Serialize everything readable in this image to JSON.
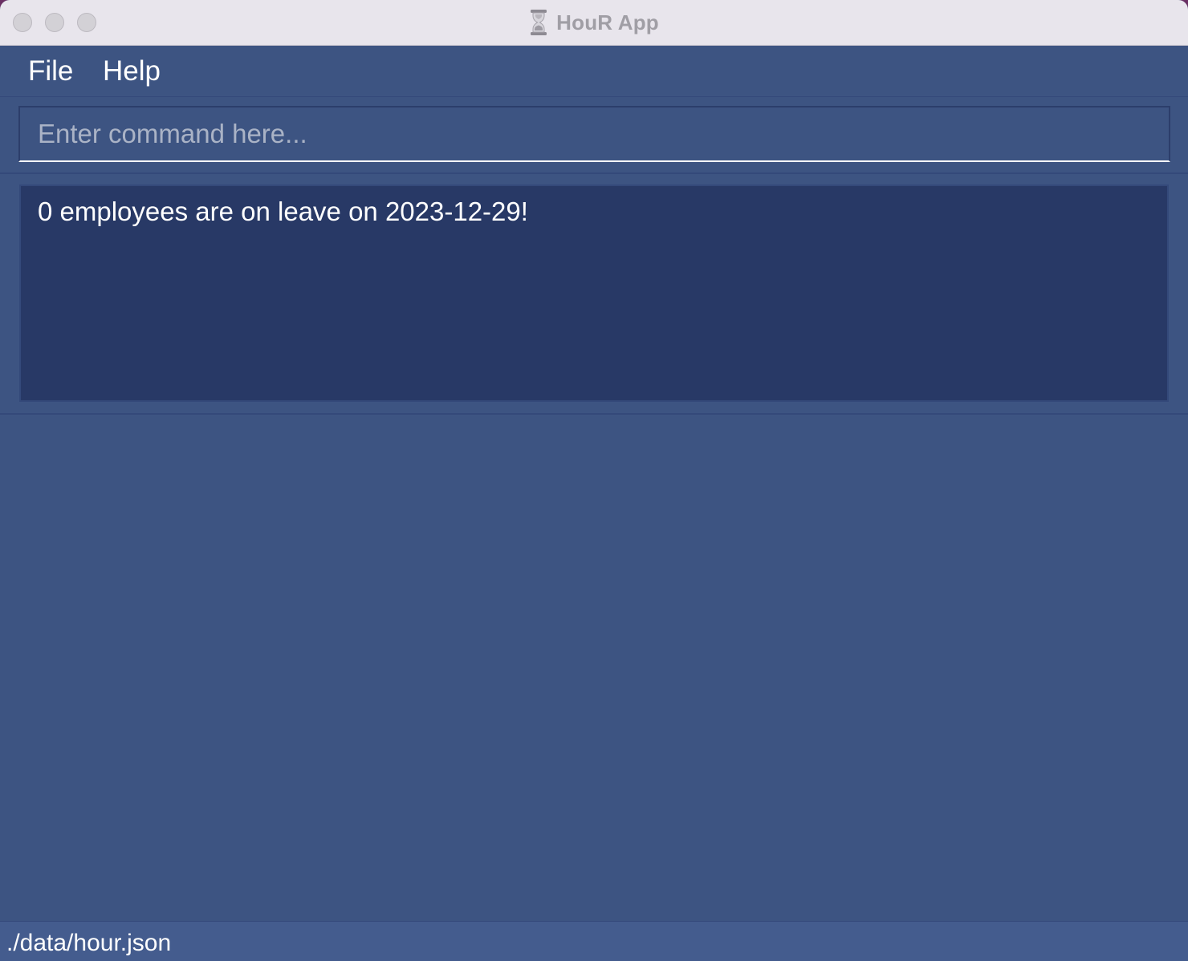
{
  "window": {
    "title": "HouR App",
    "title_icon": "hourglass-icon"
  },
  "menubar": {
    "items": [
      {
        "label": "File"
      },
      {
        "label": "Help"
      }
    ]
  },
  "command": {
    "placeholder": "Enter command here...",
    "value": ""
  },
  "result": {
    "message": "0 employees are on leave on 2023-12-29!"
  },
  "statusbar": {
    "path": "./data/hour.json"
  },
  "colors": {
    "background": "#3d5482",
    "result_background": "#283966",
    "titlebar": "#e8e5ec",
    "text": "#ffffff"
  }
}
